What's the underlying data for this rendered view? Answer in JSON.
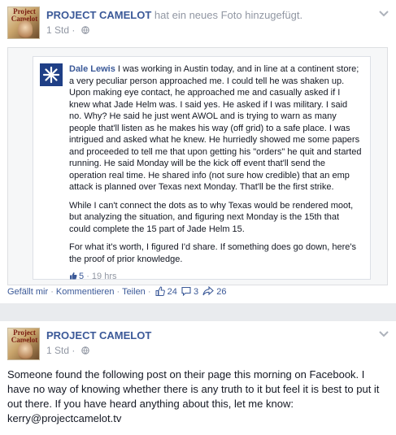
{
  "post1": {
    "author": "PROJECT CAMELOT",
    "action": "hat ein neues Foto hinzugefügt.",
    "time": "1 Std",
    "time_separator": "·",
    "avatar_text": "Project Camelot",
    "comment": {
      "author": "Dale Lewis",
      "paragraphs": [
        "I was working in Austin today, and in line at a continent store; a very peculiar person approached me. I could tell he was shaken up. Upon making eye contact, he approached me and casually asked if I knew what Jade Helm was. I said yes. He asked if I was military. I said no. Why? He said he just went AWOL and is trying to warn as many people that'll listen as he makes his way (off grid) to a safe place. I was intrigued and asked what he knew. He hurriedly showed me some papers and proceeded to tell me that upon getting his \"orders\" he quit and started running. He said Monday will be the kick off event that'll send the operation real time. He shared info (not sure how credible) that an emp attack is planned over Texas next Monday. That'll be the first strike.",
        "While I can't connect the dots as to why Texas would be rendered moot, but analyzing the situation, and figuring next Monday is the 15th that could complete the 15 part of Jade Helm 15.",
        "For what it's worth, I figured I'd share. If something does go down, here's the proof of prior knowledge."
      ],
      "likes": "5",
      "time": "19 hrs",
      "separator": "·"
    },
    "actions": {
      "like": "Gefällt mir",
      "comment": "Kommentieren",
      "share": "Teilen",
      "separator": "·",
      "like_count": "24",
      "comment_count": "3",
      "share_count": "26"
    }
  },
  "post2": {
    "author": "PROJECT CAMELOT",
    "time": "1 Std",
    "time_separator": "·",
    "avatar_text": "Project Camelot",
    "text": "Someone found the following post on their page this morning on Facebook. I have no way of knowing whether there is any truth to it but feel it is best to put it out there. If you have heard anything about this, let me know: kerry@projectcamelot.tv"
  },
  "colors": {
    "link": "#3b5998",
    "meta": "#9197a3",
    "text": "#141823",
    "divider": "#e9ebee"
  }
}
